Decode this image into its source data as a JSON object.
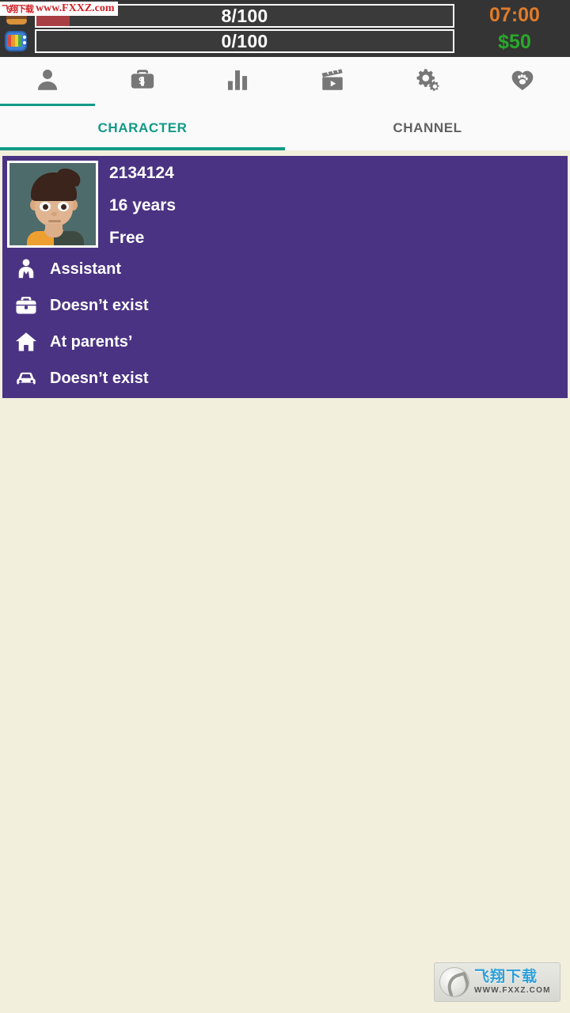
{
  "status_bar": {
    "icons": [
      {
        "name": "food-icon",
        "semantic": "burger-icon"
      },
      {
        "name": "tv-icon",
        "semantic": "tv-icon"
      }
    ],
    "bars": [
      {
        "name": "energy-bar",
        "label": "8/100",
        "value": 8,
        "max": 100,
        "percent": 8,
        "fill_color": "#a83f45"
      },
      {
        "name": "fans-bar",
        "label": "0/100",
        "value": 0,
        "max": 100,
        "percent": 0,
        "fill_color": "#a83f45"
      }
    ],
    "clock": "07:00",
    "clock_color": "#e07b2a",
    "money": "$50",
    "money_color": "#2aa82a",
    "background_color": "#343434"
  },
  "icon_tabs": {
    "active_index": 0,
    "accent_color": "#129a87",
    "items": [
      {
        "icon": "person-icon",
        "label": "Character"
      },
      {
        "icon": "briefcase-dollar-icon",
        "label": "Work"
      },
      {
        "icon": "bar-chart-icon",
        "label": "Statistics"
      },
      {
        "icon": "clapperboard-icon",
        "label": "Videos"
      },
      {
        "icon": "gears-icon",
        "label": "Settings"
      },
      {
        "icon": "heart-paw-icon",
        "label": "Pets"
      }
    ]
  },
  "text_tabs": {
    "active_index": 0,
    "items": [
      {
        "label": "CHARACTER"
      },
      {
        "label": "CHANNEL"
      }
    ]
  },
  "character_card": {
    "background_color": "#4b3383",
    "avatar": {
      "name": "character-avatar",
      "description": "boy with dark spiky hair, orange and dark shirt"
    },
    "id": "2134124",
    "age": "16 years",
    "status": "Free",
    "stats": [
      {
        "icon": "job-person-icon",
        "label": "Assistant"
      },
      {
        "icon": "briefcase-icon",
        "label": "Doesn’t exist"
      },
      {
        "icon": "house-icon",
        "label": "At parents’"
      },
      {
        "icon": "car-icon",
        "label": "Doesn’t exist"
      }
    ]
  },
  "watermarks": {
    "top": {
      "cn": "飞翔下载",
      "en": "www.FXXZ.com"
    },
    "bottom": {
      "cn": "飞翔下载",
      "en": "WWW.FXXZ.COM"
    }
  },
  "page": {
    "background_color": "#f2efdd"
  }
}
